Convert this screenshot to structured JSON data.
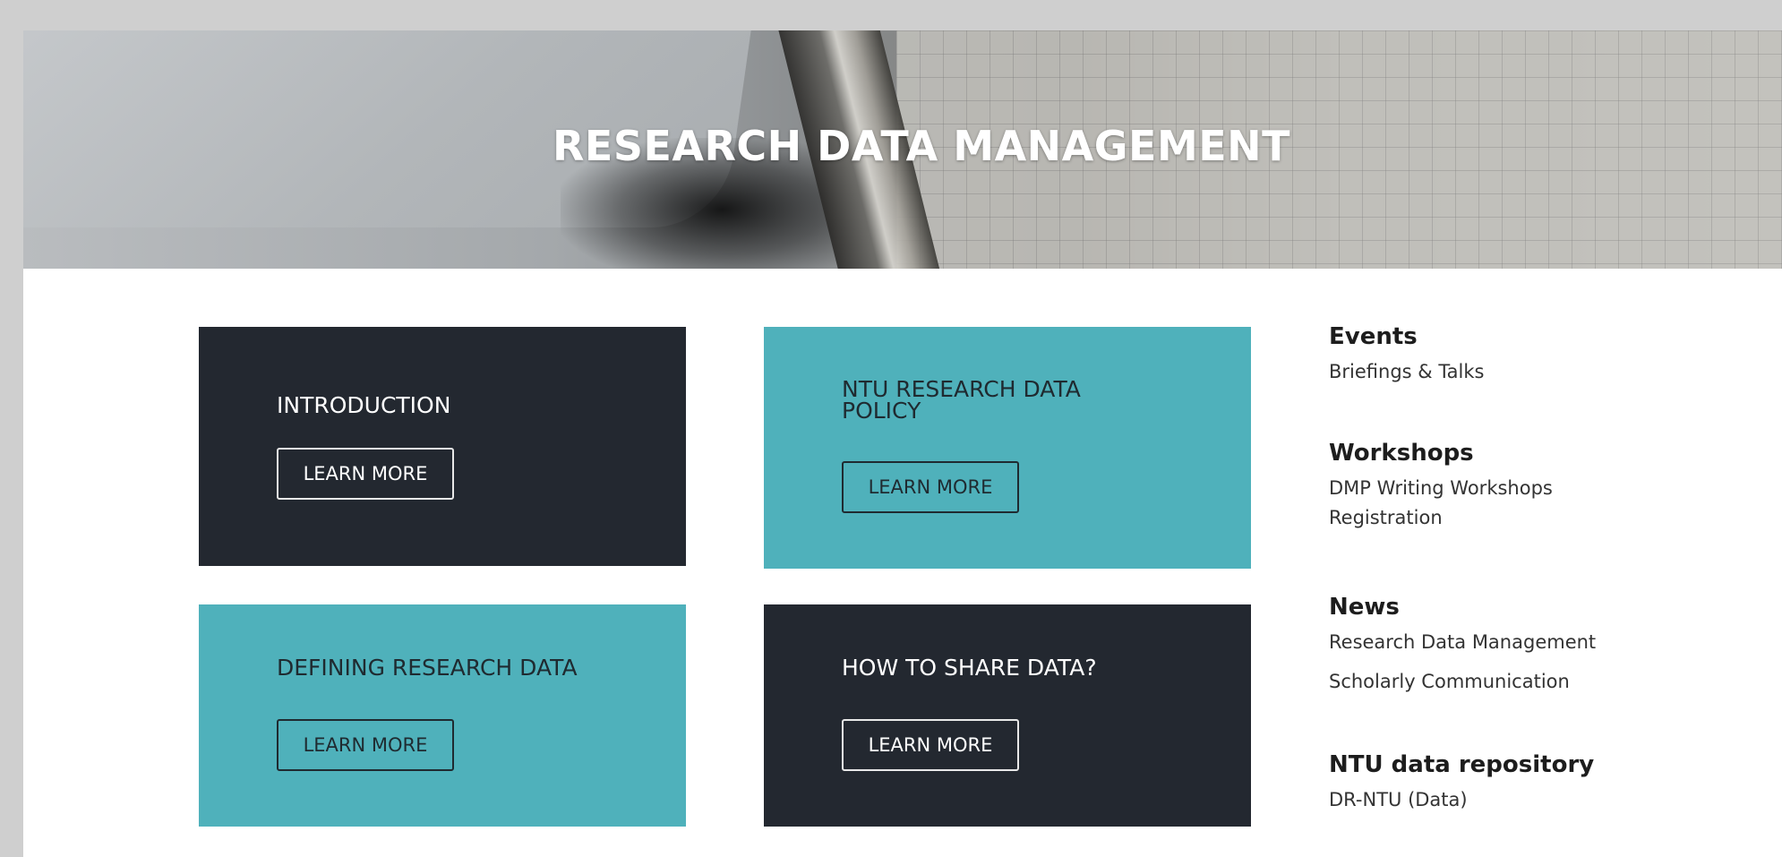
{
  "hero": {
    "title": "RESEARCH DATA MANAGEMENT"
  },
  "tiles": [
    {
      "title": "INTRODUCTION",
      "button": "LEARN MORE",
      "style": "dark"
    },
    {
      "title": "NTU RESEARCH DATA POLICY",
      "button": "LEARN MORE",
      "style": "teal"
    },
    {
      "title": "DEFINING RESEARCH DATA",
      "button": "LEARN MORE",
      "style": "teal"
    },
    {
      "title": "HOW TO SHARE DATA?",
      "button": "LEARN MORE",
      "style": "dark"
    }
  ],
  "sidebar": {
    "sections": [
      {
        "heading": "Events",
        "links": [
          "Briefings & Talks"
        ]
      },
      {
        "heading": "Workshops",
        "links": [
          "DMP Writing Workshops Registration"
        ]
      },
      {
        "heading": "News",
        "links": [
          "Research Data Management",
          "Scholarly Communication"
        ]
      },
      {
        "heading": "NTU data repository",
        "links": [
          "DR-NTU (Data)"
        ]
      }
    ]
  },
  "colors": {
    "dark_tile": "#232830",
    "teal_tile": "#4fb1bb",
    "page_background": "#cfcfcf"
  }
}
